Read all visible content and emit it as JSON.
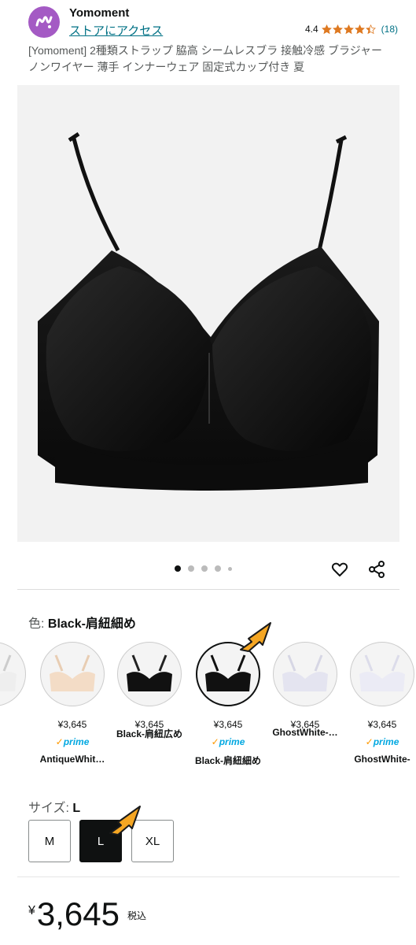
{
  "store": {
    "name": "Yomoment",
    "link_label": "ストアにアクセス",
    "rating": "4.4",
    "rating_count": "(18)",
    "stars": 4.4,
    "brand_color": "#a45ac4"
  },
  "product": {
    "title": "[Yomoment] 2種類ストラップ 脇高 シームレスブラ 接触冷感 ブラジャー ノンワイヤー 薄手 インナーウェア 固定式カップ付き 夏"
  },
  "carousel": {
    "total_dots": 5,
    "active_index": 0
  },
  "color": {
    "label": "色: ",
    "selected": "Black-肩紐細め",
    "options": [
      {
        "price": "",
        "prime": "",
        "name": "…",
        "tone": "#eeeeee",
        "strap": "#cccccc"
      },
      {
        "price": "¥3,645",
        "prime": "prime",
        "name": "AntiqueWhit…",
        "tone": "#f3dcc6",
        "strap": "#e8cdb3"
      },
      {
        "price": "¥3,645",
        "prime": "",
        "name": "Black-肩紐広め",
        "tone": "#111111",
        "strap": "#222222"
      },
      {
        "price": "¥3,645",
        "prime": "prime",
        "name": "Black-肩紐細め",
        "tone": "#111111",
        "strap": "#111111"
      },
      {
        "price": "¥3,645",
        "prime": "",
        "name": "GhostWhite-…",
        "tone": "#e4e4f0",
        "strap": "#d6d6e4"
      },
      {
        "price": "¥3,645",
        "prime": "prime",
        "name": "GhostWhite-",
        "tone": "#ebebf5",
        "strap": "#dcdcea"
      }
    ]
  },
  "size": {
    "label": "サイズ: ",
    "selected": "L",
    "options": [
      "M",
      "L",
      "XL"
    ]
  },
  "price": {
    "currency": "¥",
    "amount": "3,645",
    "tax_label": "税込"
  },
  "colors": {
    "link": "#007185",
    "star": "#de7921",
    "prime": "#00a8e1",
    "arrow": "#f5a623"
  }
}
